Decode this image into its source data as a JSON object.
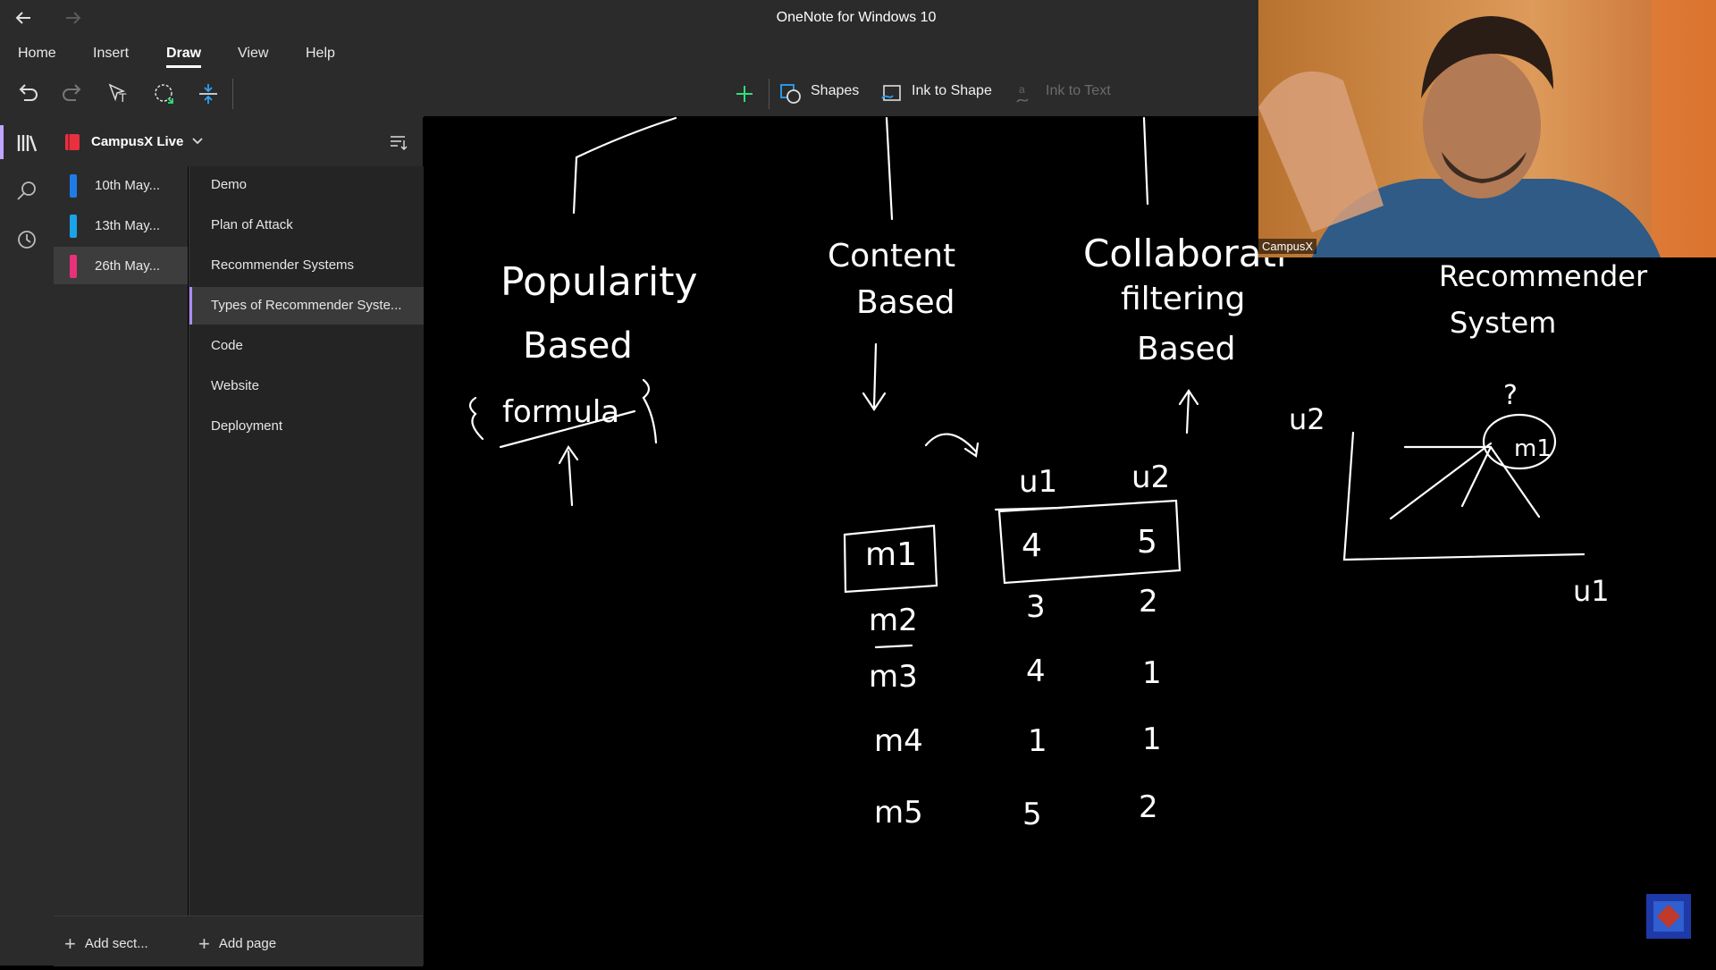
{
  "window": {
    "title": "OneNote for Windows 10",
    "back_icon": "arrow-left-icon",
    "forward_icon": "arrow-right-icon"
  },
  "menu": {
    "tabs": [
      "Home",
      "Insert",
      "Draw",
      "View",
      "Help"
    ],
    "active": "Draw"
  },
  "toolbar": {
    "shapes_label": "Shapes",
    "ink_to_shape_label": "Ink to Shape",
    "ink_to_text_label": "Ink to Text",
    "pens": [
      {
        "name": "pencil-gradient",
        "color": "#b06be0"
      },
      {
        "name": "pen-white-selected",
        "color": "#ffffff"
      },
      {
        "name": "pen-cyan",
        "color": "#29c5f6"
      },
      {
        "name": "pen-red",
        "color": "#e8253a"
      },
      {
        "name": "highlighter-white",
        "color": "#ffffff"
      },
      {
        "name": "pen-green",
        "color": "#2fe07a"
      },
      {
        "name": "pen-pink",
        "color": "#f5266b"
      },
      {
        "name": "pen-galaxy",
        "color": "#c8c8c8"
      },
      {
        "name": "pen-purple",
        "color": "#9a4de8"
      },
      {
        "name": "pen-magenta",
        "color": "#f03db5"
      },
      {
        "name": "pen-yellow",
        "color": "#ffe632"
      }
    ],
    "add_pen_icon": "plus-icon"
  },
  "notebook": {
    "name": "CampusX Live",
    "color": "#e8313f"
  },
  "sections": [
    {
      "label": "10th May...",
      "color": "#1e7ce8",
      "selected": false
    },
    {
      "label": "13th May...",
      "color": "#1aa3e8",
      "selected": false
    },
    {
      "label": "26th May...",
      "color": "#e8317a",
      "selected": true
    }
  ],
  "pages": [
    {
      "label": "Demo",
      "selected": false
    },
    {
      "label": "Plan of Attack",
      "selected": false
    },
    {
      "label": "Recommender Systems",
      "selected": false
    },
    {
      "label": "Types of Recommender Syste...",
      "selected": true
    },
    {
      "label": "Code",
      "selected": false
    },
    {
      "label": "Website",
      "selected": false
    },
    {
      "label": "Deployment",
      "selected": false
    }
  ],
  "bottom": {
    "add_section": "Add sect...",
    "add_page": "Add page"
  },
  "webcam": {
    "label": "CampusX"
  },
  "ink": {
    "popularity": [
      "Popularity",
      "Based",
      "formula"
    ],
    "content": [
      "Content",
      "Based"
    ],
    "collab": [
      "Collaborati",
      "filtering",
      "Based"
    ],
    "recsys": [
      "Recommender",
      "System"
    ],
    "table_headers": [
      "u1",
      "u2"
    ],
    "table_rows": [
      {
        "movie": "m1",
        "u1": "4",
        "u2": "5"
      },
      {
        "movie": "m2",
        "u1": "3",
        "u2": "2"
      },
      {
        "movie": "m3",
        "u1": "4",
        "u2": "1"
      },
      {
        "movie": "m4",
        "u1": "1",
        "u2": "1"
      },
      {
        "movie": "m5",
        "u1": "5",
        "u2": "2"
      }
    ],
    "graph": {
      "y_axis": "u2",
      "x_axis": "u1",
      "point": "m1",
      "question": "?"
    }
  }
}
